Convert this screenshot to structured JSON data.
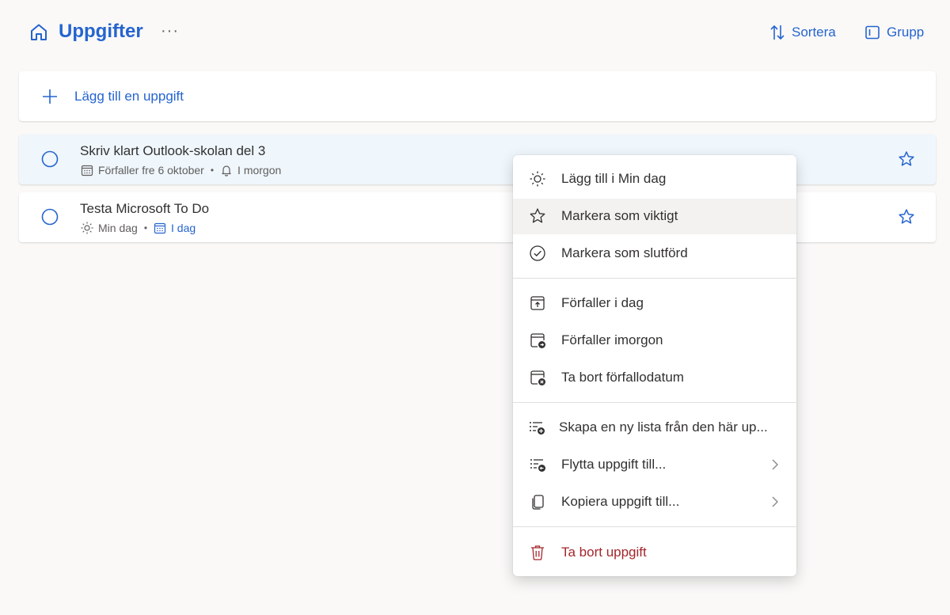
{
  "header": {
    "title": "Uppgifter",
    "more": "···",
    "sort_label": "Sortera",
    "group_label": "Grupp"
  },
  "add_task": {
    "label": "Lägg till en uppgift"
  },
  "tasks": [
    {
      "title": "Skriv klart Outlook-skolan del 3",
      "due": "Förfaller fre 6 oktober",
      "reminder": "I morgon",
      "separator": "•"
    },
    {
      "title": "Testa Microsoft To Do",
      "myday": "Min dag",
      "due": "I dag",
      "separator": "•"
    }
  ],
  "context_menu": {
    "items": [
      {
        "label": "Lägg till i Min dag",
        "icon": "sun-icon"
      },
      {
        "label": "Markera som viktigt",
        "icon": "star-icon"
      },
      {
        "label": "Markera som slutförd",
        "icon": "check-circle-icon"
      },
      {
        "label": "Förfaller i dag",
        "icon": "calendar-today-icon"
      },
      {
        "label": "Förfaller imorgon",
        "icon": "calendar-tomorrow-icon"
      },
      {
        "label": "Ta bort förfallodatum",
        "icon": "calendar-remove-icon"
      },
      {
        "label": "Skapa en ny lista från den här up...",
        "icon": "list-add-icon"
      },
      {
        "label": "Flytta uppgift till...",
        "icon": "list-move-icon"
      },
      {
        "label": "Kopiera uppgift till...",
        "icon": "copy-icon"
      },
      {
        "label": "Ta bort uppgift",
        "icon": "trash-icon"
      }
    ]
  },
  "colors": {
    "accent": "#2564cf",
    "danger": "#a4262c",
    "background": "#faf9f8",
    "selected_row": "#eff6fc"
  }
}
